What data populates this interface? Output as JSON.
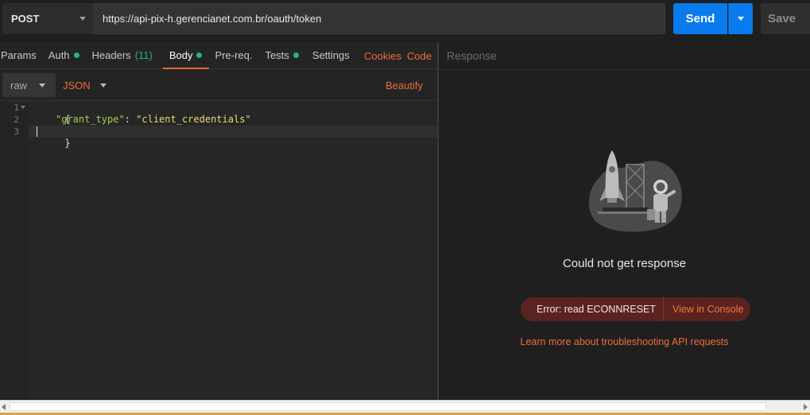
{
  "request": {
    "method": "POST",
    "url": "https://api-pix-h.gerencianet.com.br/oauth/token",
    "send_label": "Send",
    "save_label": "Save"
  },
  "tabs": {
    "params": "Params",
    "auth": "Auth",
    "headers": "Headers",
    "headers_count": "(11)",
    "body": "Body",
    "prereq": "Pre-req.",
    "tests": "Tests",
    "settings": "Settings",
    "cookies": "Cookies",
    "code": "Code"
  },
  "body_options": {
    "mode": "raw",
    "format": "JSON",
    "beautify": "Beautify"
  },
  "editor": {
    "line_numbers": [
      "1",
      "2",
      "3"
    ],
    "open_brace": "{",
    "key": "\"grant_type\"",
    "colon": ": ",
    "value": "\"client_credentials\"",
    "close_brace": "}"
  },
  "response": {
    "title": "Response",
    "message": "Could not get response",
    "error_text": "Error: read ECONNRESET",
    "view_console": "View in Console",
    "learn_more": "Learn more about troubleshooting API requests"
  },
  "colors": {
    "accent": "#f26b3a",
    "send": "#097bed",
    "status_dot": "#26b47f",
    "error_bg": "#5a2320"
  }
}
